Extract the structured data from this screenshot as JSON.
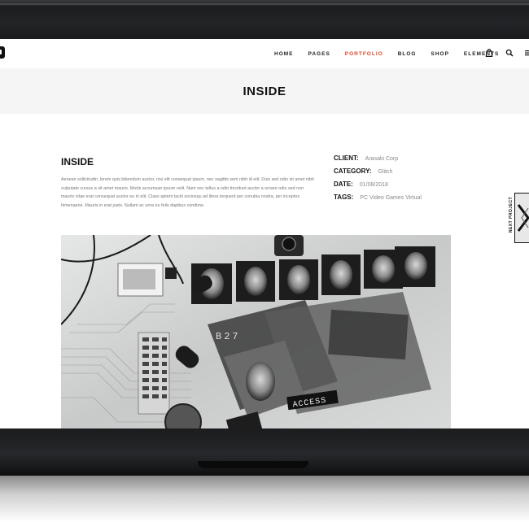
{
  "nav": {
    "items": [
      {
        "label": "HOME",
        "active": false
      },
      {
        "label": "PAGES",
        "active": false
      },
      {
        "label": "PORTFOLIO",
        "active": true
      },
      {
        "label": "BLOG",
        "active": false
      },
      {
        "label": "SHOP",
        "active": false
      },
      {
        "label": "ELEMENTS",
        "active": false
      }
    ],
    "icons": [
      "bag-icon",
      "search-icon",
      "menu-icon"
    ],
    "accent": "#e0462c"
  },
  "header": {
    "title": "INSIDE"
  },
  "project": {
    "title": "INSIDE",
    "description": "Aenean sollicitudin, lorem quis bibendum auctor, nisi elit consequat ipsum, nec sagittis sem nibh id elit. Duis sed odio sit amet nibh vulputate cursus a sit amet mauris. Morbi accumsan ipsum velit. Nam nec tellus a odio tincidunt auctor a ornare odio sed non mauris vitae erat consequat auctor eu in elit. Class aptent taciti sociosqu ad litora torquent per conubia nostra, per inceptos himenaeos. Mauris in erat justo. Nullam ac urna eu felis dapibus condime.",
    "meta": [
      {
        "key": "CLIENT:",
        "value": "Arasaki Corp"
      },
      {
        "key": "CATEGORY:",
        "value": "Glitch"
      },
      {
        "key": "DATE:",
        "value": "01/08/2018"
      },
      {
        "key": "TAGS:",
        "value": "PC Video Games Virtual"
      }
    ]
  },
  "next_project": {
    "label": "NEXT PROJECT"
  },
  "hero_overlay": {
    "screen_text": "B27",
    "stamp": "ACCESS"
  }
}
